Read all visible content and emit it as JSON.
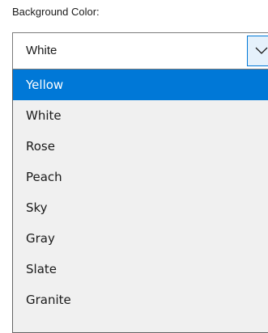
{
  "field": {
    "label": "Background Color:",
    "selected_value": "White",
    "dropdown_icon": "chevron-down-icon"
  },
  "options": [
    {
      "label": "Yellow",
      "highlighted": true
    },
    {
      "label": "White",
      "highlighted": false
    },
    {
      "label": "Rose",
      "highlighted": false
    },
    {
      "label": "Peach",
      "highlighted": false
    },
    {
      "label": "Sky",
      "highlighted": false
    },
    {
      "label": "Gray",
      "highlighted": false
    },
    {
      "label": "Slate",
      "highlighted": false
    },
    {
      "label": "Granite",
      "highlighted": false
    }
  ],
  "colors": {
    "highlight": "#0078d7",
    "list_background": "#f0f0f0",
    "text": "#1a1a1a"
  }
}
